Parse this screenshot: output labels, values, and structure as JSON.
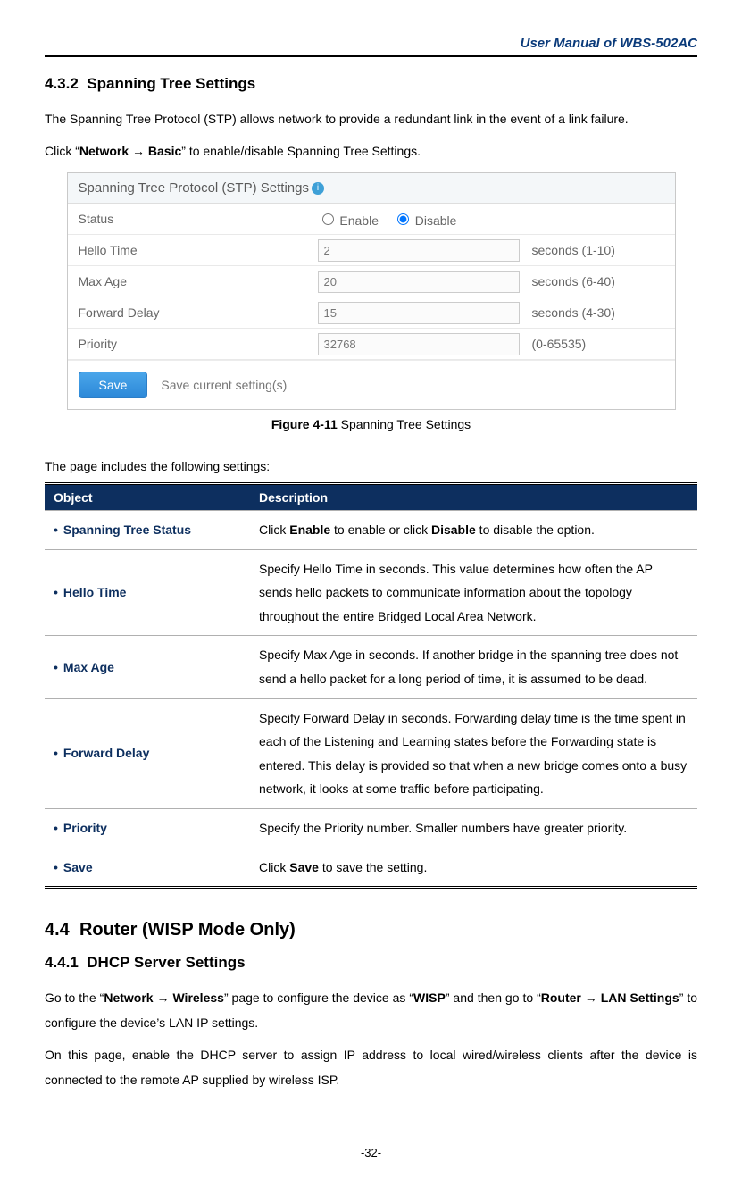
{
  "header": {
    "manual_title": "User Manual of WBS-502AC",
    "page_number": "-32-"
  },
  "section_432": {
    "number": "4.3.2",
    "title": "Spanning Tree Settings",
    "intro_line1": "The Spanning Tree Protocol (STP) allows network to provide a redundant link in the event of a link failure.",
    "intro_prefix": "Click “",
    "intro_bold": "Network → Basic",
    "intro_suffix": "” to enable/disable Spanning Tree Settings."
  },
  "stp_panel": {
    "title": "Spanning Tree Protocol (STP) Settings",
    "rows": {
      "status_label": "Status",
      "enable_label": "Enable",
      "disable_label": "Disable",
      "hello_label": "Hello Time",
      "hello_value": "2",
      "hello_hint": "seconds (1-10)",
      "maxage_label": "Max Age",
      "maxage_value": "20",
      "maxage_hint": "seconds (6-40)",
      "fwd_label": "Forward Delay",
      "fwd_value": "15",
      "fwd_hint": "seconds (4-30)",
      "prio_label": "Priority",
      "prio_value": "32768",
      "prio_hint": "(0-65535)"
    },
    "save_button": "Save",
    "save_hint": "Save current setting(s)"
  },
  "figure": {
    "label_bold": "Figure 4-11",
    "label_rest": " Spanning Tree Settings"
  },
  "settings_intro": "The page includes the following settings:",
  "table": {
    "head_object": "Object",
    "head_desc": "Description",
    "rows": [
      {
        "object": "Spanning Tree Status",
        "desc_pre": "Click ",
        "desc_b1": "Enable",
        "desc_mid": " to enable or click ",
        "desc_b2": "Disable",
        "desc_post": " to disable the option."
      },
      {
        "object": "Hello Time",
        "desc": "Specify Hello Time in seconds. This value determines how often the AP sends hello packets to communicate information about the topology throughout the entire Bridged Local Area Network."
      },
      {
        "object": "Max Age",
        "desc": "Specify Max Age in seconds. If another bridge in the spanning tree does not send a hello packet for a long period of time, it is assumed to be dead."
      },
      {
        "object": "Forward Delay",
        "desc": "Specify Forward Delay in seconds. Forwarding delay time is the time spent in each of the Listening and Learning states before the Forwarding state is entered. This delay is provided so that when a new bridge comes onto a busy network, it looks at some traffic before participating."
      },
      {
        "object": "Priority",
        "desc": "Specify the Priority number. Smaller numbers have greater priority."
      },
      {
        "object": "Save",
        "desc_pre": "Click ",
        "desc_b1": "Save",
        "desc_post": " to save the setting."
      }
    ]
  },
  "section_44": {
    "number": "4.4",
    "title": "Router (WISP Mode Only)"
  },
  "section_441": {
    "number": "4.4.1",
    "title": "DHCP Server Settings",
    "p1_a": "Go to the “",
    "p1_b": "Network → Wireless",
    "p1_c": "” page to configure the device as “",
    "p1_d": "WISP",
    "p1_e": "” and then go to “",
    "p1_f": "Router → LAN Settings",
    "p1_g": "” to configure the device’s LAN IP settings.",
    "p2": "On this page, enable the DHCP server to assign IP address to local wired/wireless clients after the device is connected to the remote AP supplied by wireless ISP."
  }
}
